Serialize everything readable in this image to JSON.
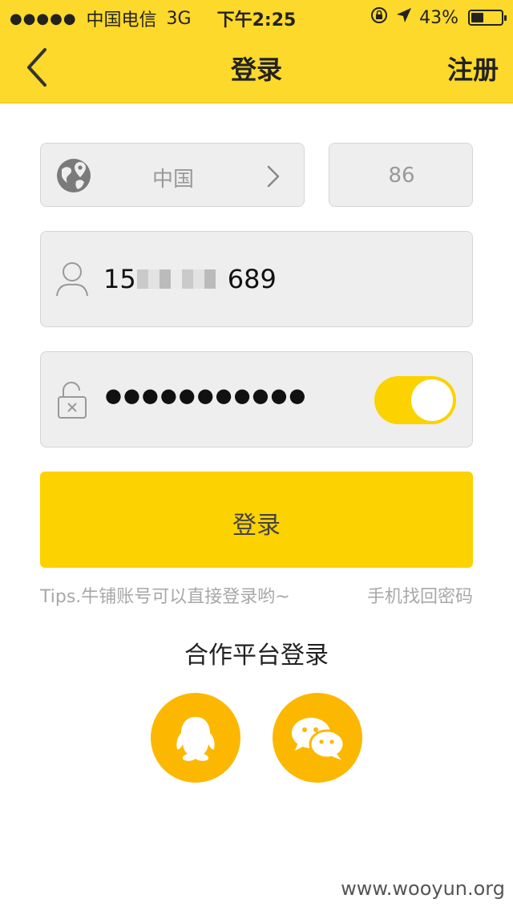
{
  "status_bar": {
    "signal": "●●●●●",
    "carrier": "中国电信",
    "network": "3G",
    "time": "下午2:25",
    "battery_percent": "43%",
    "battery_level": 0.43
  },
  "nav": {
    "back_icon": "chevron-left-icon",
    "title": "登录",
    "register_label": "注册"
  },
  "form": {
    "country": {
      "icon": "globe-pin-icon",
      "name": "中国",
      "chevron_icon": "chevron-right-icon"
    },
    "country_code": "86",
    "phone": {
      "icon": "user-icon",
      "value_prefix": "15",
      "value_suffix": "689"
    },
    "password": {
      "icon": "unlock-icon",
      "masked_value": "●●●●●●●●●●●",
      "show_toggle_on": true
    },
    "login_label": "登录"
  },
  "tips": "Tips.牛铺账号可以直接登录哟~",
  "forgot_label": "手机找回密码",
  "partner_title": "合作平台登录",
  "partners": [
    {
      "icon": "qq-icon"
    },
    {
      "icon": "wechat-icon"
    }
  ],
  "watermark": "www.wooyun.org",
  "colors": {
    "brand_yellow": "#fcd92a",
    "button_yellow": "#fcd200",
    "social_orange": "#fcb800"
  }
}
